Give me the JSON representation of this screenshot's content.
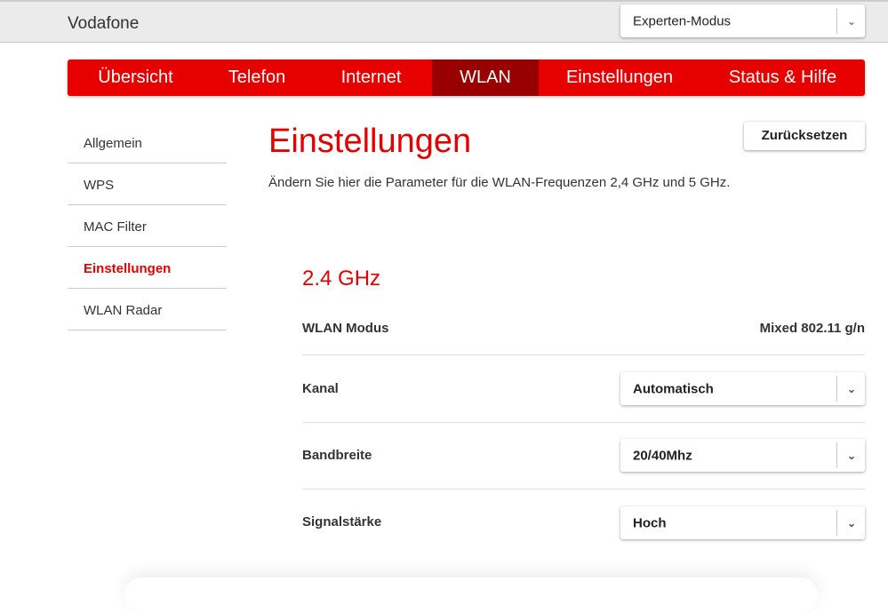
{
  "header": {
    "brand": "Vodafone",
    "mode": "Experten-Modus"
  },
  "nav": [
    "Übersicht",
    "Telefon",
    "Internet",
    "WLAN",
    "Einstellungen",
    "Status & Hilfe"
  ],
  "sidebar": [
    "Allgemein",
    "WPS",
    "MAC Filter",
    "Einstellungen",
    "WLAN Radar"
  ],
  "main": {
    "title": "Einstellungen",
    "description": "Ändern Sie hier die Parameter für die WLAN-Frequenzen 2,4 GHz und 5 GHz.",
    "reset": "Zurücksetzen",
    "section": "2.4 GHz",
    "mode_label": "WLAN Modus",
    "mode_value": "Mixed 802.11 g/n",
    "channel_label": "Kanal",
    "channel_value": "Automatisch",
    "bandwidth_label": "Bandbreite",
    "bandwidth_value": "20/40Mhz",
    "signal_label": "Signalstärke",
    "signal_value": "Hoch"
  }
}
